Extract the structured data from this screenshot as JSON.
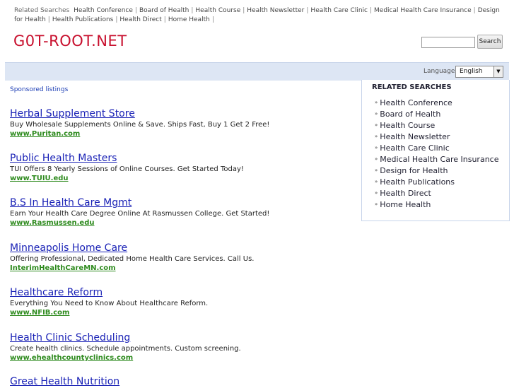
{
  "top_links": {
    "lead": "Related Searches",
    "items": [
      "Health Conference",
      "Board of Health",
      "Health Course",
      "Health Newsletter",
      "Health Care Clinic",
      "Medical Health Care Insurance",
      "Design for Health",
      "Health Publications",
      "Health Direct",
      "Home Health"
    ]
  },
  "logo": "G0T-ROOT.NET",
  "search": {
    "value": "",
    "button": "Search"
  },
  "language": {
    "label": "Language:",
    "selected": "English"
  },
  "sponsored_label": "Sponsored listings",
  "ads": [
    {
      "title": "Herbal Supplement Store",
      "desc": "Buy Wholesale Supplements Online & Save. Ships Fast, Buy 1 Get 2 Free!",
      "url": "www.Puritan.com"
    },
    {
      "title": "Public Health Masters",
      "desc": "TUI Offers 8 Yearly Sessions of Online Courses. Get Started Today!",
      "url": "www.TUIU.edu"
    },
    {
      "title": "B.S In Health Care Mgmt",
      "desc": "Earn Your Health Care Degree Online At Rasmussen College. Get Started!",
      "url": "www.Rasmussen.edu"
    },
    {
      "title": "Minneapolis Home Care",
      "desc": "Offering Professional, Dedicated Home Health Care Services. Call Us.",
      "url": "InterimHealthCareMN.com"
    },
    {
      "title": "Healthcare Reform",
      "desc": "Everything You Need to Know About Healthcare Reform.",
      "url": "www.NFIB.com"
    },
    {
      "title": "Health Clinic Scheduling",
      "desc": "Create health clinics. Schedule appointments. Custom screening.",
      "url": "www.ehealthcountyclinics.com"
    },
    {
      "title": "Great Health Nutrition",
      "desc": "",
      "url": ""
    }
  ],
  "related": {
    "heading": "RELATED SEARCHES",
    "items": [
      "Health Conference",
      "Board of Health",
      "Health Course",
      "Health Newsletter",
      "Health Care Clinic",
      "Medical Health Care Insurance",
      "Design for Health",
      "Health Publications",
      "Health Direct",
      "Home Health"
    ]
  },
  "icons": {
    "bullet": "»",
    "dropdown": "▼"
  },
  "colors": {
    "logo": "#c8102e",
    "ad_title": "#1a22b6",
    "ad_url": "#2d8a1d",
    "band": "#dde6f4"
  }
}
